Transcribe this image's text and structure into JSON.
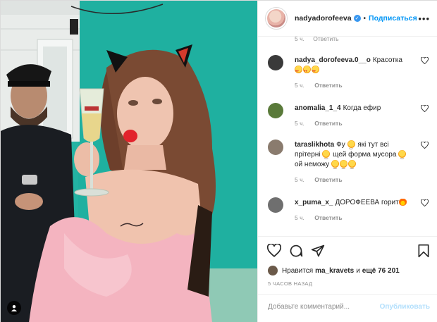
{
  "post": {
    "author": "nadyadorofeeva",
    "separator": "•",
    "follow_label": "Подписаться"
  },
  "partial_row": {
    "time": "5 ч.",
    "reply_label": "Ответить"
  },
  "comments": [
    {
      "user": "nadya_dorofeeva.0__o",
      "text": "Красотка",
      "emoji_line": [
        "heart-eyes",
        "heart-eyes",
        "heart-eyes"
      ],
      "time": "5 ч.",
      "reply_label": "Ответить",
      "avatar_color": "#3a3a3a"
    },
    {
      "user": "anomalia_1_4",
      "text": "Когда ефир",
      "time": "5 ч.",
      "reply_label": "Ответить",
      "avatar_color": "#5a7a3a"
    },
    {
      "user": "taraslikhota",
      "text_before_emoji": "Фу",
      "text_after_emoji1": "які тут всі прітерні",
      "text_after_emoji2": "щей форма мусора",
      "text_after_emoji3": "ой неможу",
      "time": "5 ч.",
      "reply_label": "Ответить",
      "avatar_color": "#8a7b6e"
    },
    {
      "user": "x_puma_x_",
      "text": "ДОРОФЕЕВА горит",
      "time": "5 ч.",
      "reply_label": "Ответить",
      "avatar_color": "#6f6f6f"
    }
  ],
  "likes": {
    "prefix": "Нравится",
    "user": "ma_kravets",
    "middle": "и",
    "count": "ещё 76 201"
  },
  "timestamp": "5 ЧАСОВ НАЗАД",
  "add_comment": {
    "placeholder": "Добавьте комментарий...",
    "publish_label": "Опубликовать"
  },
  "colors": {
    "accent": "#0095f6",
    "publish_disabled": "#b2dffc",
    "muted": "#8e8e8e",
    "backdrop": "#1fa89a"
  }
}
